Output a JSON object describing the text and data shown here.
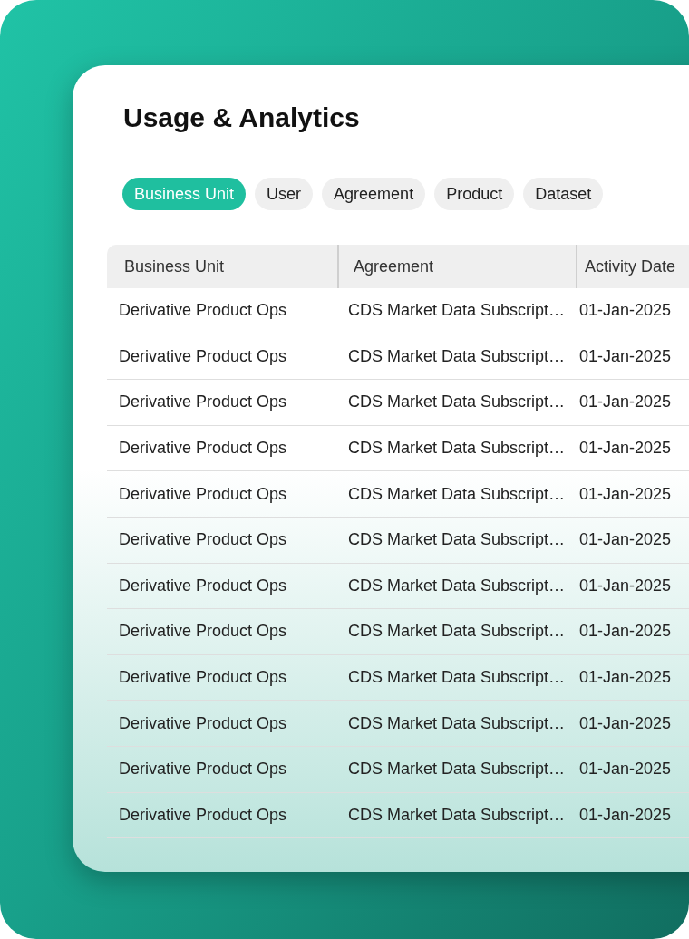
{
  "title": "Usage & Analytics",
  "tabs": [
    {
      "label": "Business Unit",
      "selected": true
    },
    {
      "label": "User",
      "selected": false
    },
    {
      "label": "Agreement",
      "selected": false
    },
    {
      "label": "Product",
      "selected": false
    },
    {
      "label": "Dataset",
      "selected": false
    }
  ],
  "table": {
    "columns": [
      "Business Unit",
      "Agreement",
      "Activity Date"
    ],
    "rows": [
      [
        "Derivative Product Ops",
        "CDS Market Data Subscript…",
        "01-Jan-2025"
      ],
      [
        "Derivative Product Ops",
        "CDS Market Data Subscript…",
        "01-Jan-2025"
      ],
      [
        "Derivative Product Ops",
        "CDS Market Data Subscript…",
        "01-Jan-2025"
      ],
      [
        "Derivative Product Ops",
        "CDS Market Data Subscript…",
        "01-Jan-2025"
      ],
      [
        "Derivative Product Ops",
        "CDS Market Data Subscript…",
        "01-Jan-2025"
      ],
      [
        "Derivative Product Ops",
        "CDS Market Data Subscript…",
        "01-Jan-2025"
      ],
      [
        "Derivative Product Ops",
        "CDS Market Data Subscript…",
        "01-Jan-2025"
      ],
      [
        "Derivative Product Ops",
        "CDS Market Data Subscript…",
        "01-Jan-2025"
      ],
      [
        "Derivative Product Ops",
        "CDS Market Data Subscript…",
        "01-Jan-2025"
      ],
      [
        "Derivative Product Ops",
        "CDS Market Data Subscript…",
        "01-Jan-2025"
      ],
      [
        "Derivative Product Ops",
        "CDS Market Data Subscript…",
        "01-Jan-2025"
      ],
      [
        "Derivative Product Ops",
        "CDS Market Data Subscript…",
        "01-Jan-2025"
      ]
    ]
  }
}
